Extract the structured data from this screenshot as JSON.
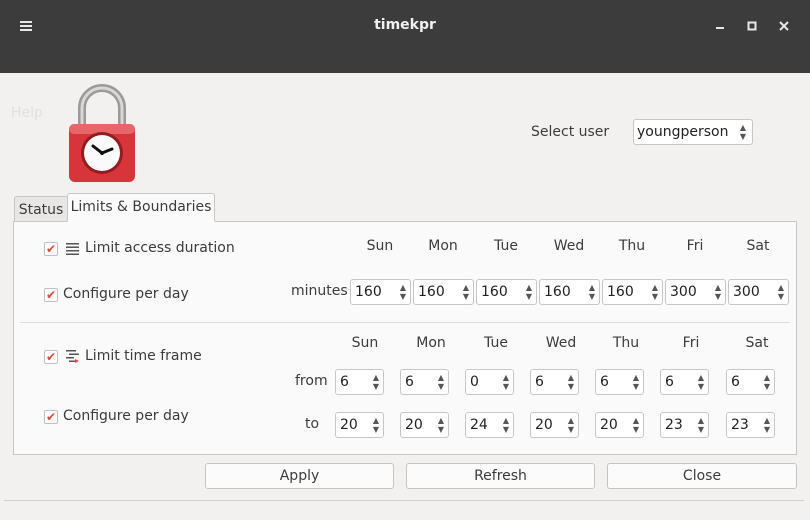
{
  "window": {
    "title": "timekpr"
  },
  "menu": {
    "help": "Help"
  },
  "user_select": {
    "label": "Select user",
    "value": "youngperson"
  },
  "tabs": [
    {
      "label": "Status"
    },
    {
      "label": "Limits & Boundaries"
    }
  ],
  "duration": {
    "limit_label": "Limit access duration",
    "per_day_label": "Configure per day",
    "unit_label": "minutes",
    "days": [
      "Sun",
      "Mon",
      "Tue",
      "Wed",
      "Thu",
      "Fri",
      "Sat"
    ],
    "values": [
      "160",
      "160",
      "160",
      "160",
      "160",
      "300",
      "300"
    ]
  },
  "timeframe": {
    "limit_label": "Limit time frame",
    "per_day_label": "Configure per day",
    "from_label": "from",
    "to_label": "to",
    "days": [
      "Sun",
      "Mon",
      "Tue",
      "Wed",
      "Thu",
      "Fri",
      "Sat"
    ],
    "from_values": [
      "6",
      "6",
      "0",
      "6",
      "6",
      "6",
      "6"
    ],
    "to_values": [
      "20",
      "20",
      "24",
      "20",
      "20",
      "23",
      "23"
    ]
  },
  "buttons": {
    "apply": "Apply",
    "refresh": "Refresh",
    "close": "Close"
  },
  "colors": {
    "titlebar": "#3c3c3c",
    "check": "#e0463a",
    "lock_red": "#d9343a"
  }
}
